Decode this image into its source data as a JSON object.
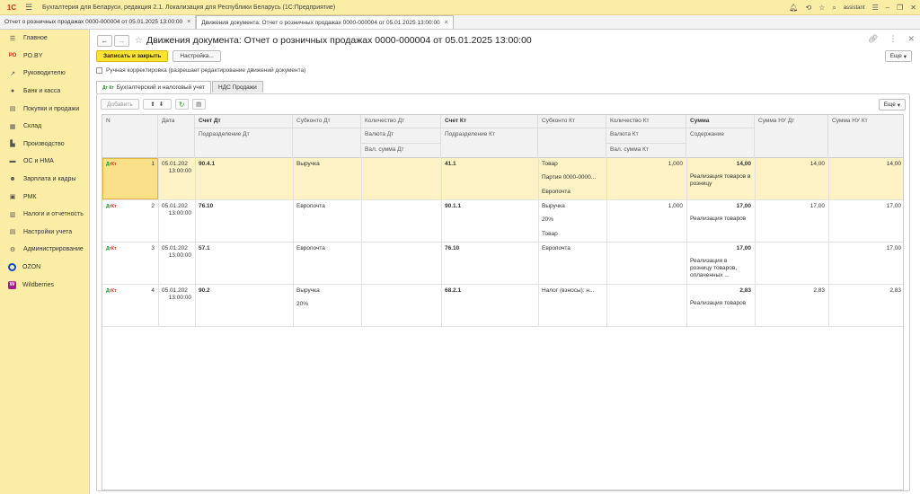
{
  "app": {
    "title": "Бухгалтерия для Беларуси, редакция 2.1. Локализация для Республики Беларусь",
    "platform": "(1С:Предприятие)",
    "logo": "1С",
    "user": "assistant"
  },
  "doc_tabs": [
    {
      "label": "Отчет о розничных продажах 0000-000004 от 05.01.2025 13:00:00",
      "active": false
    },
    {
      "label": "Движения документа: Отчет о розничных продажах 0000-000004 от 05.01.2025 13:00:00",
      "active": true
    }
  ],
  "sidebar": {
    "items": [
      {
        "label": "Главное",
        "icon": "menu-icon"
      },
      {
        "label": "PO.BY",
        "icon": "poby-icon"
      },
      {
        "label": "Руководителю",
        "icon": "chart-icon"
      },
      {
        "label": "Банк и касса",
        "icon": "bank-icon"
      },
      {
        "label": "Покупки и продажи",
        "icon": "cart-icon"
      },
      {
        "label": "Склад",
        "icon": "warehouse-icon"
      },
      {
        "label": "Производство",
        "icon": "factory-icon"
      },
      {
        "label": "ОС и НМА",
        "icon": "truck-icon"
      },
      {
        "label": "Зарплата и кадры",
        "icon": "people-icon"
      },
      {
        "label": "РМК",
        "icon": "register-icon"
      },
      {
        "label": "Налоги и отчетность",
        "icon": "report-icon"
      },
      {
        "label": "Настройки учета",
        "icon": "settings-icon"
      },
      {
        "label": "Администрирование",
        "icon": "gear-icon"
      },
      {
        "label": "OZON",
        "icon": "ozon-icon"
      },
      {
        "label": "Wildberries",
        "icon": "wildberries-icon"
      }
    ]
  },
  "form": {
    "title": "Движения документа: Отчет о розничных продажах 0000-000004 от 05.01.2025 13:00:00",
    "save_close": "Записать и закрыть",
    "settings": "Настройка...",
    "more": "Еще",
    "manual_correction": "Ручная корректировка (разрешает редактирование движений документа)",
    "tabs": [
      "Бухгалтерский и налоговый учет",
      "НДС Продажи"
    ],
    "dk_mark": "Дт Кт"
  },
  "table": {
    "add": "Добавить",
    "more": "Еще",
    "headers": {
      "n": "N",
      "date": "Дата",
      "dt": "Счет Дт",
      "sub_dt": "Субконто Дт",
      "qty_dt": "Количество Дт",
      "kt": "Счет Кт",
      "sub_kt": "Субконто Кт",
      "qty_kt": "Количество Кт",
      "sum": "Сумма",
      "nu_dt": "Сумма НУ Дт",
      "nu_kt": "Сумма НУ Кт",
      "dept_dt": "Подразделение Дт",
      "cur_dt": "Валюта Дт",
      "cur_sum_dt": "Вал. сумма Дт",
      "dept_kt": "Подразделение Кт",
      "cur_kt": "Валюта Кт",
      "cur_sum_kt": "Вал. сумма Кт",
      "content": "Содержание"
    },
    "rows": [
      {
        "n": "1",
        "date": "05.01.202",
        "time": "13:00:00",
        "dt": "90.4.1",
        "sub_dt": [
          "Выручка",
          "",
          ""
        ],
        "qty_dt": "",
        "kt": "41.1",
        "sub_kt": [
          "Товар",
          "Партия 0000-0000...",
          "Европочта"
        ],
        "qty_kt": "1,000",
        "sum": "14,00",
        "content": "Реализация товаров в розницу",
        "nu_dt": "14,00",
        "nu_kt": "14,00"
      },
      {
        "n": "2",
        "date": "05.01.202",
        "time": "13:00:00",
        "dt": "76.10",
        "sub_dt": [
          "Европочта",
          "",
          ""
        ],
        "qty_dt": "",
        "kt": "90.1.1",
        "sub_kt": [
          "Выручка",
          "20%",
          "Товар"
        ],
        "qty_kt": "1,000",
        "sum": "17,00",
        "content": "Реализация товаров",
        "nu_dt": "17,00",
        "nu_kt": "17,00"
      },
      {
        "n": "3",
        "date": "05.01.202",
        "time": "13:00:00",
        "dt": "57.1",
        "sub_dt": [
          "Европочта",
          "",
          ""
        ],
        "qty_dt": "",
        "kt": "76.10",
        "sub_kt": [
          "Европочта",
          "",
          ""
        ],
        "qty_kt": "",
        "sum": "17,00",
        "content": "Реализация в розницу товаров, оплаченных ...",
        "nu_dt": "",
        "nu_kt": "17,00"
      },
      {
        "n": "4",
        "date": "05.01.202",
        "time": "13:00:00",
        "dt": "90.2",
        "sub_dt": [
          "Выручка",
          "20%",
          ""
        ],
        "qty_dt": "",
        "kt": "68.2.1",
        "sub_kt": [
          "Налог (взносы): н...",
          "",
          ""
        ],
        "qty_kt": "",
        "sum": "2,83",
        "content": "Реализация товаров",
        "nu_dt": "2,83",
        "nu_kt": "2,83"
      }
    ]
  }
}
